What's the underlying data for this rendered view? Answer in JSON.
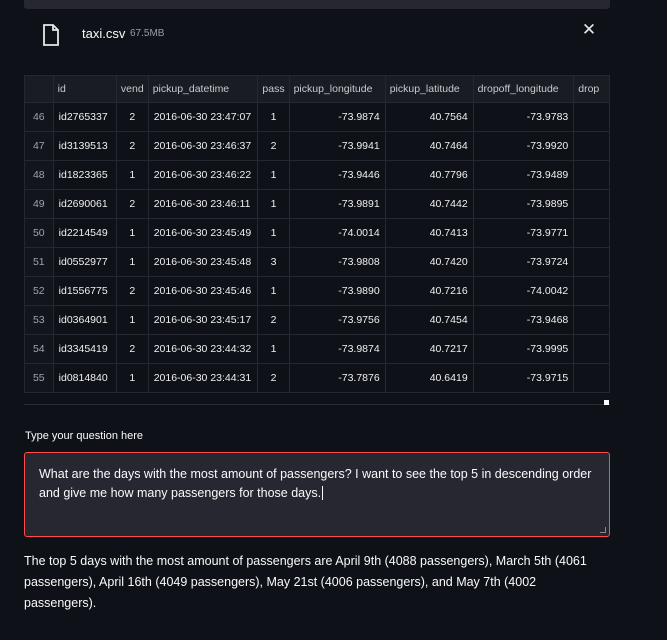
{
  "file": {
    "name": "taxi.csv",
    "size": "67.5MB"
  },
  "table": {
    "columns": [
      "",
      "id",
      "vend",
      "pickup_datetime",
      "pass",
      "pickup_longitude",
      "pickup_latitude",
      "dropoff_longitude",
      "drop"
    ],
    "rows": [
      [
        "46",
        "id2765337",
        "2",
        "2016-06-30 23:47:07",
        "1",
        "-73.9874",
        "40.7564",
        "-73.9783",
        ""
      ],
      [
        "47",
        "id3139513",
        "2",
        "2016-06-30 23:46:37",
        "2",
        "-73.9941",
        "40.7464",
        "-73.9920",
        ""
      ],
      [
        "48",
        "id1823365",
        "1",
        "2016-06-30 23:46:22",
        "1",
        "-73.9446",
        "40.7796",
        "-73.9489",
        ""
      ],
      [
        "49",
        "id2690061",
        "2",
        "2016-06-30 23:46:11",
        "1",
        "-73.9891",
        "40.7442",
        "-73.9895",
        ""
      ],
      [
        "50",
        "id2214549",
        "1",
        "2016-06-30 23:45:49",
        "1",
        "-74.0014",
        "40.7413",
        "-73.9771",
        ""
      ],
      [
        "51",
        "id0552977",
        "1",
        "2016-06-30 23:45:48",
        "3",
        "-73.9808",
        "40.7420",
        "-73.9724",
        ""
      ],
      [
        "52",
        "id1556775",
        "2",
        "2016-06-30 23:45:46",
        "1",
        "-73.9890",
        "40.7216",
        "-74.0042",
        ""
      ],
      [
        "53",
        "id0364901",
        "1",
        "2016-06-30 23:45:17",
        "2",
        "-73.9756",
        "40.7454",
        "-73.9468",
        ""
      ],
      [
        "54",
        "id3345419",
        "2",
        "2016-06-30 23:44:32",
        "1",
        "-73.9874",
        "40.7217",
        "-73.9995",
        ""
      ],
      [
        "55",
        "id0814840",
        "1",
        "2016-06-30 23:44:31",
        "2",
        "-73.7876",
        "40.6419",
        "-73.9715",
        ""
      ]
    ]
  },
  "question": {
    "label": "Type your question here",
    "value": "What are the days with the most amount of passengers? I want to see the top 5 in descending order and give me how many passengers for those days."
  },
  "answer": "The top 5 days with the most amount of passengers are April 9th (4088 passengers), March 5th (4061 passengers), April 16th (4049 passengers), May 21st (4006 passengers), and May 7th (4002 passengers).",
  "colors": {
    "background": "#0e1117",
    "panel": "#262730",
    "focus_border": "#ff4b4b"
  },
  "icons": {
    "file": "file-icon",
    "close": "close-icon"
  }
}
